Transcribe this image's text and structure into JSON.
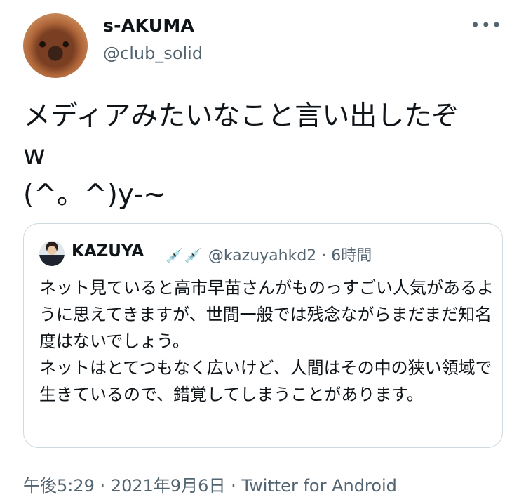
{
  "author": {
    "name": "s-AKUMA",
    "handle": "@club_solid",
    "avatar_icon": "dog-avatar-photo"
  },
  "more_icon": "more-horizontal-icon",
  "more_glyph": "•••",
  "tweet": {
    "text": "メディアみたいなこと言い出したぞ\nw\n(^。^)y-~"
  },
  "quoted_tweet": {
    "name": "KAZUYA",
    "emoji_icon": "syringe-icon",
    "emoji_glyph": "💉",
    "handle": "@kazuyahkd2",
    "separator": "·",
    "time": "6時間",
    "text": "ネット見ていると高市早苗さんがものっすごい人気があるように思えてきますが、世間一般では残念ながらまだまだ知名度はないでしょう。\nネットはとてつもなく広いけど、人間はその中の狭い領域で生きているので、錯覚してしまうことがあります。"
  },
  "footer": {
    "time": "午後5:29",
    "sep1": "·",
    "date": "2021年9月6日",
    "sep2": "·",
    "source": "Twitter for Android"
  },
  "colors": {
    "text": "#0f1419",
    "secondary": "#536471",
    "border": "#cfd9de"
  }
}
